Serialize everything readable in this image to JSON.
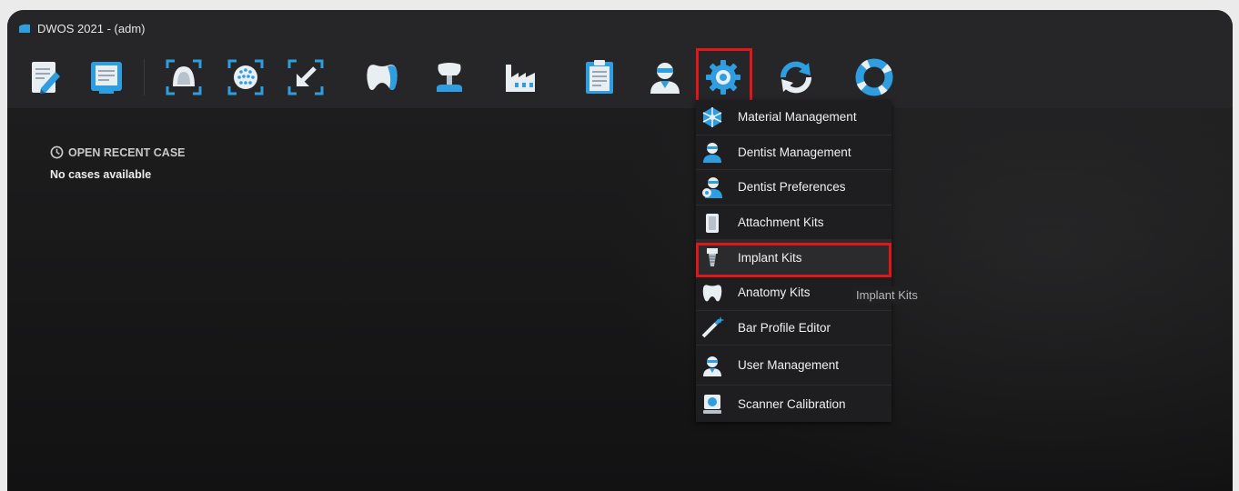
{
  "window": {
    "title": "DWOS 2021 - (adm)"
  },
  "toolbar": {
    "buttons": [
      {
        "name": "new-order",
        "icon": "edit-document-icon"
      },
      {
        "name": "open-order",
        "icon": "monitor-document-icon"
      },
      {
        "name": "scan-model",
        "icon": "scan-arch-icon"
      },
      {
        "name": "scan-impression",
        "icon": "scan-dots-icon"
      },
      {
        "name": "import",
        "icon": "import-arrow-icon"
      },
      {
        "name": "design",
        "icon": "tooth-icon"
      },
      {
        "name": "implant",
        "icon": "implant-tooth-icon"
      },
      {
        "name": "production",
        "icon": "factory-icon"
      },
      {
        "name": "reports",
        "icon": "clipboard-icon"
      },
      {
        "name": "dentist",
        "icon": "dentist-icon"
      },
      {
        "name": "settings",
        "icon": "gear-icon",
        "highlighted": true
      },
      {
        "name": "sync",
        "icon": "sync-arrows-icon"
      },
      {
        "name": "help",
        "icon": "lifebuoy-icon"
      }
    ]
  },
  "recent": {
    "header": "OPEN RECENT CASE",
    "empty": "No cases available"
  },
  "settings_menu": {
    "items": [
      {
        "label": "Material Management",
        "icon": "molecule-icon"
      },
      {
        "label": "Dentist Management",
        "icon": "dentist-icon"
      },
      {
        "label": "Dentist Preferences",
        "icon": "dentist-gear-icon"
      },
      {
        "label": "Attachment Kits",
        "icon": "attachment-kit-icon"
      },
      {
        "label": "Implant Kits",
        "icon": "implant-icon",
        "highlighted": true
      },
      {
        "label": "Anatomy Kits",
        "icon": "tooth-icon"
      },
      {
        "label": "Bar Profile Editor",
        "icon": "wand-icon"
      },
      {
        "label": "User Management",
        "icon": "user-icon"
      },
      {
        "label": "Scanner Calibration",
        "icon": "scanner-icon"
      }
    ]
  },
  "tooltip": {
    "text": "Implant Kits"
  },
  "colors": {
    "accent_blue": "#2f9ee0",
    "highlight_red": "#e0161b",
    "window_bg": "#1b1b1c",
    "toolbar_bg": "#262628"
  }
}
